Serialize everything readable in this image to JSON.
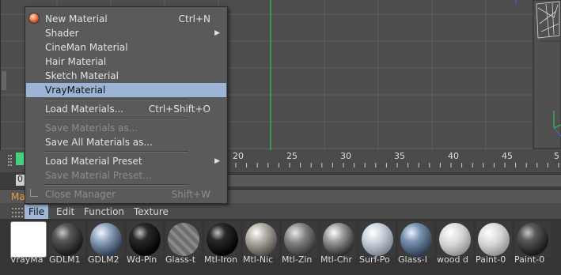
{
  "file_menu": {
    "items": [
      {
        "label": "New Material",
        "shortcut": "Ctrl+N"
      },
      {
        "label": "Shader"
      },
      {
        "label": "CineMan Material"
      },
      {
        "label": "Hair Material"
      },
      {
        "label": "Sketch Material"
      },
      {
        "label": "VrayMaterial"
      },
      {
        "label": "Load Materials...",
        "shortcut": "Ctrl+Shift+O"
      },
      {
        "label": "Save Materials as..."
      },
      {
        "label": "Save All Materials as..."
      },
      {
        "label": "Load Material Preset"
      },
      {
        "label": "Save Material Preset..."
      },
      {
        "label": "Close Manager",
        "shortcut": "Shift+W"
      }
    ]
  },
  "timeline": {
    "frame_field": "0",
    "ticks": [
      "20",
      "25",
      "30",
      "35",
      "40",
      "45",
      "5"
    ]
  },
  "material_manager": {
    "title": "Ma",
    "menus": [
      "File",
      "Edit",
      "Function",
      "Texture"
    ],
    "materials": [
      {
        "name": "VrayMa",
        "icon": "white-swatch"
      },
      {
        "name": "GDLM1",
        "icon": "dark-sphere"
      },
      {
        "name": "GDLM2",
        "icon": "blue-grey-sphere"
      },
      {
        "name": "Wd-Pin",
        "icon": "black-sphere"
      },
      {
        "name": "Glass-t",
        "icon": "glass-sphere"
      },
      {
        "name": "Mtl-Iron",
        "icon": "black-sphere"
      },
      {
        "name": "Mtl-Nic",
        "icon": "silver-sphere"
      },
      {
        "name": "Mtl-Zin",
        "icon": "grey-sphere"
      },
      {
        "name": "Mtl-Chr",
        "icon": "chrome-sphere"
      },
      {
        "name": "Surf-Po",
        "icon": "light-sphere"
      },
      {
        "name": "Glass-I",
        "icon": "blue-sphere"
      },
      {
        "name": "wood d",
        "icon": "white-sphere"
      },
      {
        "name": "Paint-0",
        "icon": "white-sphere"
      },
      {
        "name": "Paint-0",
        "icon": "dark-sphere"
      }
    ]
  },
  "colors": {
    "menu_highlight": "#9cb5d6",
    "timeline_marker": "#44d27a",
    "manager_title": "#e6a33a"
  }
}
